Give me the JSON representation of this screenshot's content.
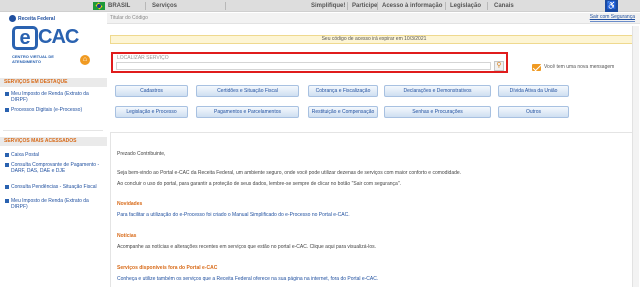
{
  "govbar": {
    "country": "BRASIL",
    "links": [
      "Serviços",
      "Simplifique!",
      "Participe",
      "Acesso à informação",
      "Legislação",
      "Canais"
    ]
  },
  "header": {
    "breadcrumb": "Titular do Código",
    "logout": "Sair com Segurança",
    "logo_agency": "Receita Federal",
    "logo_letter": "e",
    "logo_word": "CAC",
    "logo_sub": "Centro Virtual de Atendimento",
    "notice": "Seu código de acesso irá expirar em 10/3/2021"
  },
  "search": {
    "label": "LOCALIZAR SERVIÇO",
    "placeholder": "",
    "value": ""
  },
  "mailbox": {
    "text": "Você tem uma nova mensagem"
  },
  "sidebar": {
    "section1_title": "SERVIÇOS EM DESTAQUE",
    "section1_items": [
      "Meu Imposto de Renda (Extrato da DIRPF)",
      "Processos Digitais (e-Processo)"
    ],
    "section2_title": "SERVIÇOS MAIS ACESSADOS",
    "section2_items": [
      "Caixa Postal",
      "Consulta Comprovante de Pagamento - DARF, DAS, DAE e DJE",
      "Consulta Pendências - Situação Fiscal",
      "Meu Imposto de Renda (Extrato da DIRPF)"
    ]
  },
  "service_buttons": {
    "row1": [
      "Cadastros",
      "Certidões e Situação Fiscal",
      "Cobrança e Fiscalização",
      "Declarações e Demonstrativos",
      "Dívida Ativa da União"
    ],
    "row2": [
      "Legislação e Processo",
      "Pagamentos e Parcelamentos",
      "Restituição e Compensação",
      "Senhas e Procurações",
      "Outros"
    ]
  },
  "content": {
    "greeting": "Prezado Contribuinte,",
    "welcome": "Seja bem-vindo ao Portal e-CAC da Receita Federal, um ambiente seguro, onde você pode utilizar dezenas de serviços com maior conforto e comodidade.",
    "logout_tip": "Ao concluir o uso do portal, para garantir a proteção de seus dados, lembre-se sempre de clicar no botão \"Sair com segurança\".",
    "news_title": "Novidades",
    "news_text": "Para facilitar a utilização do e-Processo foi criado o Manual Simplificado do e-Processo no Portal e-CAC.",
    "notices_title": "Notícias",
    "notices_text": "Acompanhe as notícias e alterações recentes em serviços que estão no portal e-CAC. Clique aqui para visualizá-los.",
    "outside_title": "Serviços disponíveis fora do Portal e-CAC",
    "outside_text": "Conheça e utilize também os serviços que a Receita Federal oferece na sua página na internet, fora do Portal e-CAC."
  },
  "colors": {
    "brand_blue": "#1f4f9f",
    "accent_orange": "#d86a18",
    "search_highlight": "#e01c1c"
  }
}
